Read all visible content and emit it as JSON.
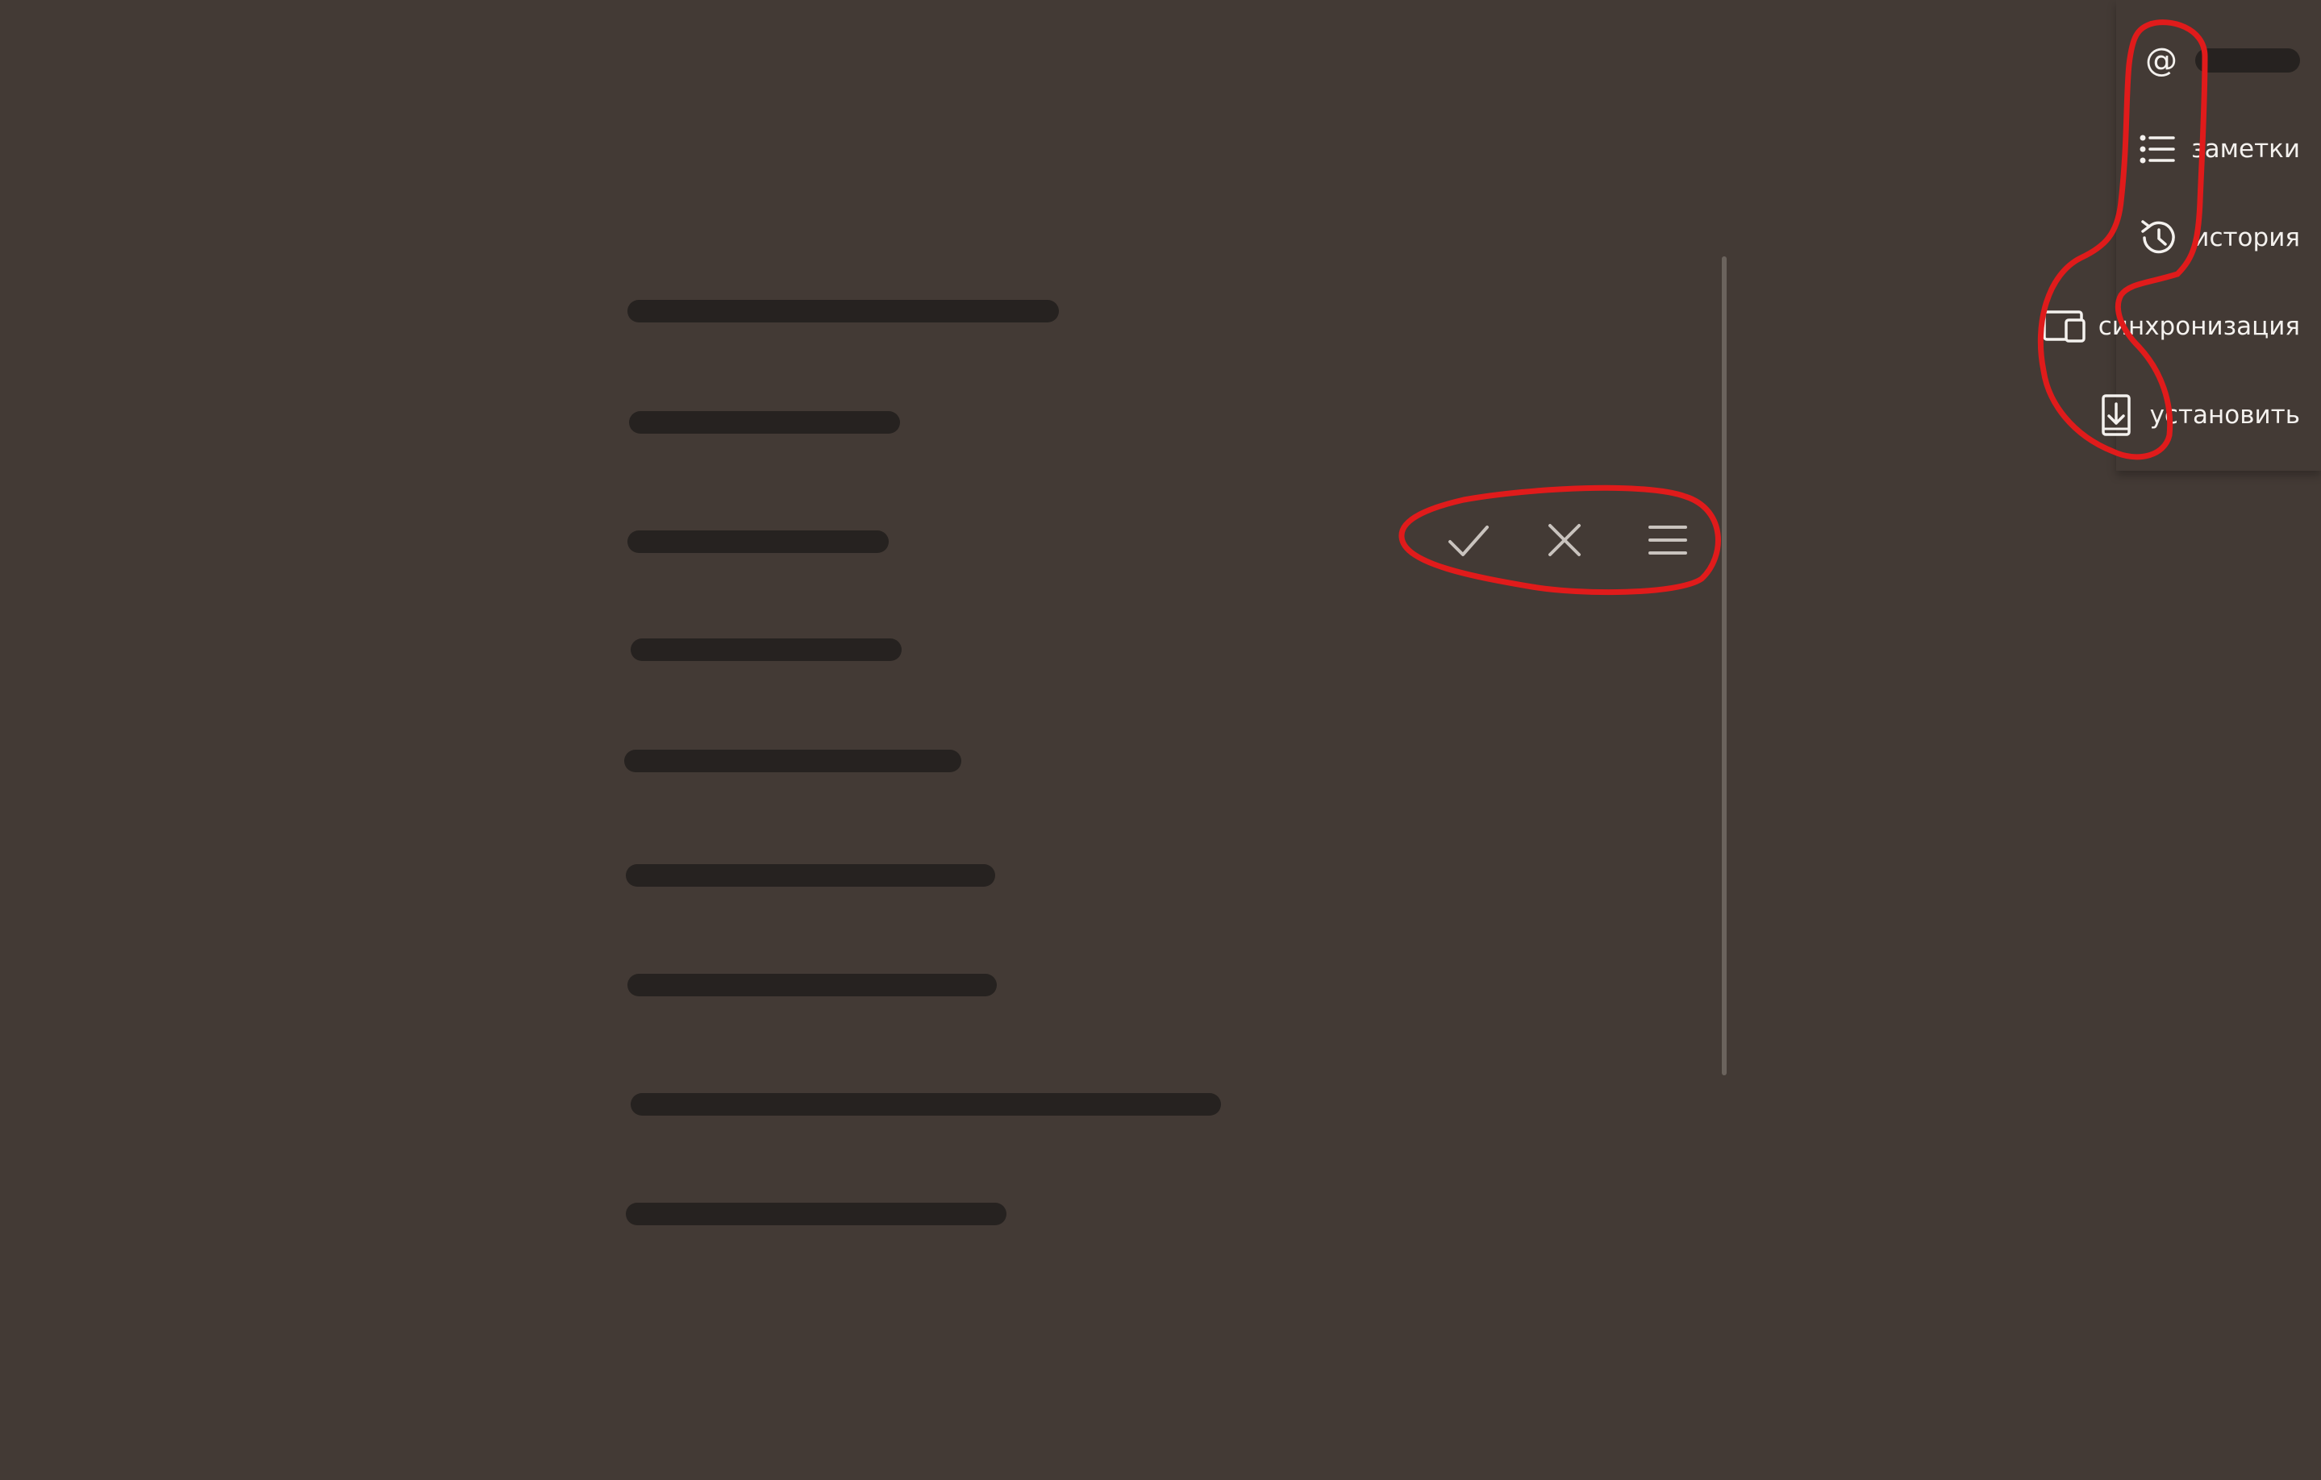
{
  "notes": {
    "items": [
      {
        "redacted": true
      },
      {
        "redacted": true
      },
      {
        "redacted": true
      },
      {
        "redacted": true
      },
      {
        "redacted": true
      },
      {
        "redacted": true
      },
      {
        "redacted": true
      },
      {
        "redacted": true
      },
      {
        "redacted": true
      }
    ]
  },
  "toolbar": {
    "confirm_icon": "check-icon",
    "cancel_icon": "close-icon",
    "menu_icon": "hamburger-icon"
  },
  "menu": {
    "account": {
      "icon": "at-icon",
      "label": ""
    },
    "notes": {
      "icon": "list-icon",
      "label": "заметки"
    },
    "history": {
      "icon": "history-icon",
      "label": "история"
    },
    "sync": {
      "icon": "devices-icon",
      "label": "синхронизация"
    },
    "install": {
      "icon": "install-icon",
      "label": "установить"
    }
  },
  "colors": {
    "background": "#433a35",
    "text": "#f4f1ee",
    "annotation": "#e01b1b",
    "redaction": "#262220"
  }
}
